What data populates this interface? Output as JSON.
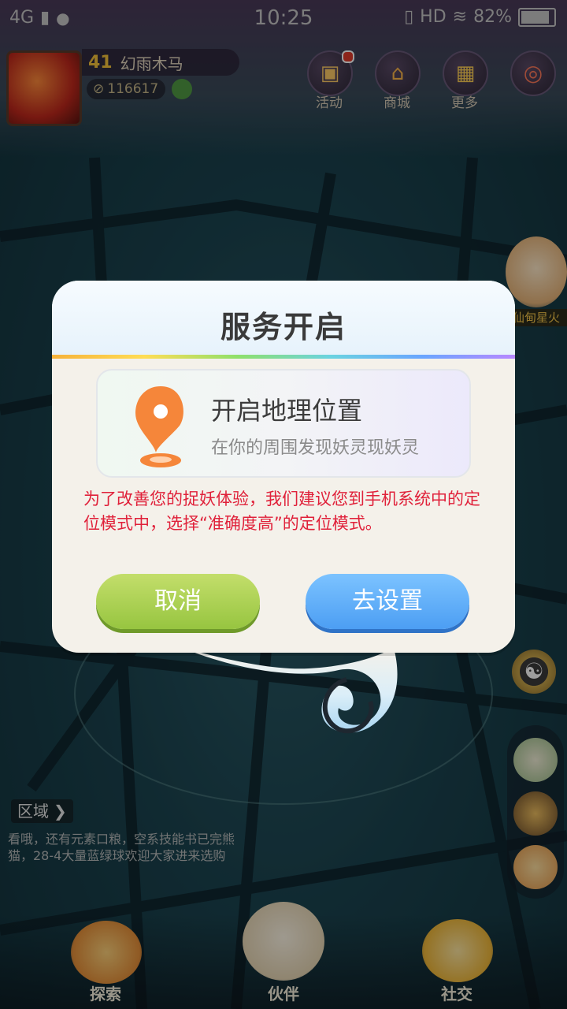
{
  "status_bar": {
    "network": "4G",
    "time": "10:25",
    "hd": "HD",
    "battery": "82%"
  },
  "hud": {
    "level": "41",
    "player_name": "幻雨木马",
    "coins": "116617",
    "buttons": [
      {
        "label": "活动",
        "icon": "gift-icon"
      },
      {
        "label": "商城",
        "icon": "shop-icon"
      },
      {
        "label": "更多",
        "icon": "grid-icon"
      },
      {
        "label": "",
        "icon": "compass-icon"
      }
    ]
  },
  "side": {
    "fire_tag": "仙甸星火",
    "taiji_icon": "taiji-icon"
  },
  "region": {
    "label": "区域"
  },
  "chat": {
    "text": "看哦，还有元素口粮，空系技能书已完熊猫，28-4大量蓝绿球欢迎大家进来选购"
  },
  "bottom_nav": [
    {
      "label": "探索",
      "icon": "explore-icon"
    },
    {
      "label": "伙伴",
      "icon": "partner-icon"
    },
    {
      "label": "社交",
      "icon": "social-icon"
    }
  ],
  "dialog": {
    "title": "服务开启",
    "info_title": "开启地理位置",
    "info_sub": "在你的周围发现妖灵现妖灵",
    "notice": "为了改善您的捉妖体验，我们建议您到手机系统中的定位模式中，选择“准确度高”的定位模式。",
    "cancel_label": "取消",
    "confirm_label": "去设置"
  },
  "colors": {
    "notice_red": "#e0213a",
    "cancel_green": "#a8cf4f",
    "confirm_blue": "#5aa9f7",
    "pin_orange": "#f5863a"
  }
}
